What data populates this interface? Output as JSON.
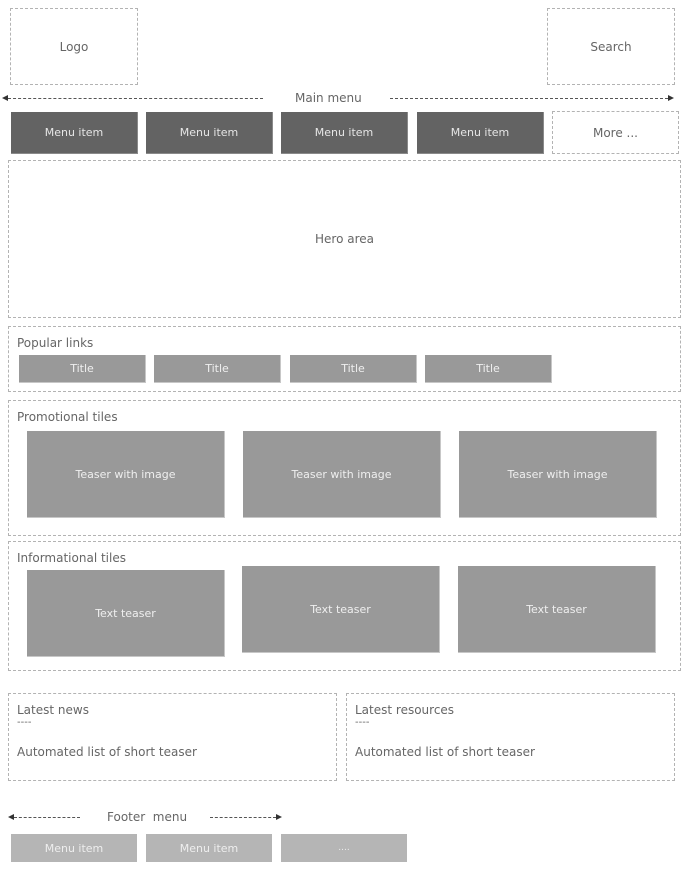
{
  "header": {
    "logo_label": "Logo",
    "search_label": "Search"
  },
  "main_menu": {
    "label": "Main menu",
    "items": [
      "Menu item",
      "Menu item",
      "Menu item",
      "Menu item"
    ],
    "more_label": "More ..."
  },
  "hero": {
    "label": "Hero area"
  },
  "popular_links": {
    "title": "Popular links",
    "items": [
      "Title",
      "Title",
      "Title",
      "Title"
    ]
  },
  "promotional_tiles": {
    "title": "Promotional tiles",
    "items": [
      "Teaser with image",
      "Teaser with image",
      "Teaser with image"
    ]
  },
  "informational_tiles": {
    "title": "Informational tiles",
    "items": [
      "Text teaser",
      "Text teaser",
      "Text teaser"
    ]
  },
  "latest_news": {
    "title": "Latest news",
    "separator": "----",
    "body": "Automated list of short teaser"
  },
  "latest_resources": {
    "title": "Latest resources",
    "separator": "----",
    "body": "Automated list of short teaser"
  },
  "footer_menu": {
    "label": "Footer  menu",
    "items": [
      "Menu item",
      "Menu item",
      "...."
    ]
  },
  "colors": {
    "menu_item_bg": "#636363",
    "tile_bg": "#999999",
    "footer_item_bg": "#b5b5b5",
    "outline": "#b3b3b3"
  }
}
